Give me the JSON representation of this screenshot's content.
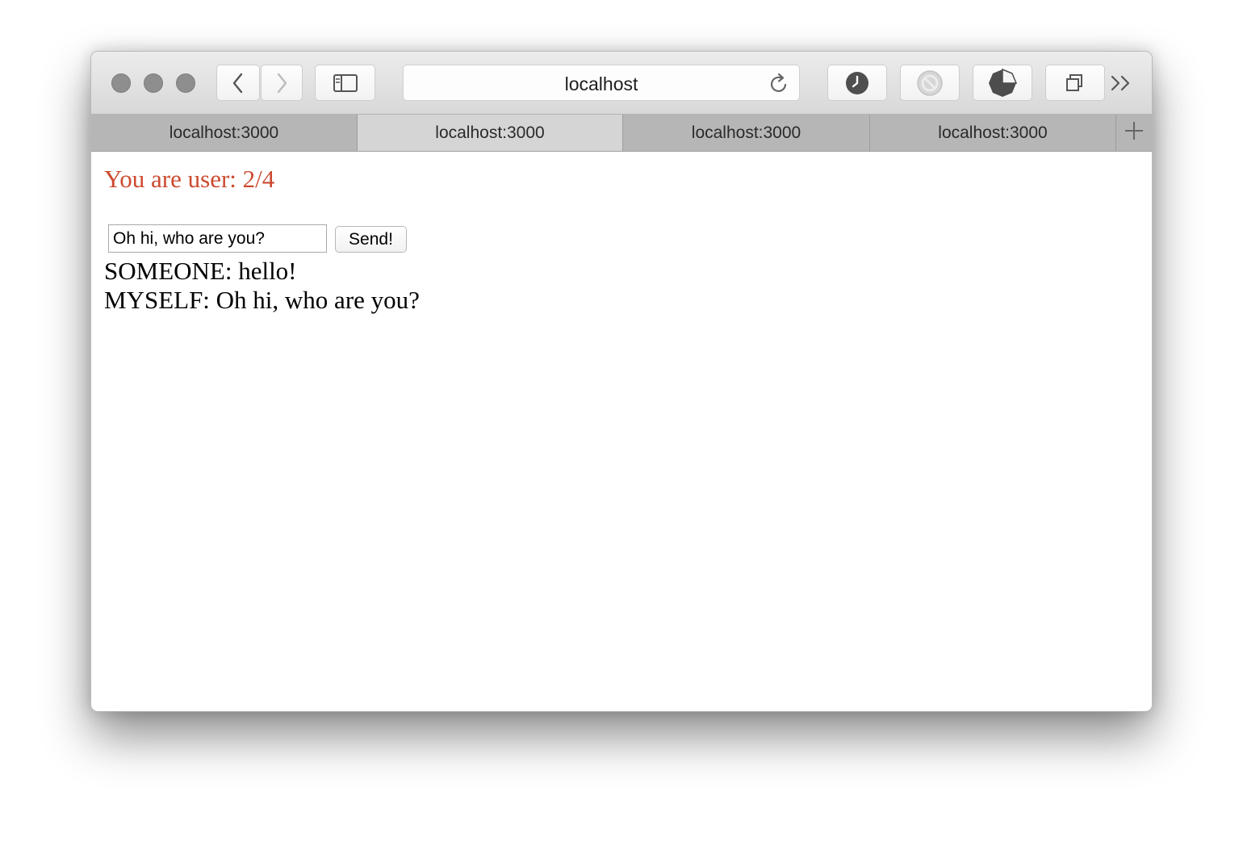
{
  "browser": {
    "address": "localhost",
    "tabs": [
      {
        "label": "localhost:3000",
        "active": false
      },
      {
        "label": "localhost:3000",
        "active": true
      },
      {
        "label": "localhost:3000",
        "active": false
      },
      {
        "label": "localhost:3000",
        "active": false
      }
    ],
    "icons": {
      "back": "chevron-left-icon",
      "forward": "chevron-right-icon",
      "sidebar": "sidebar-icon",
      "reload": "reload-icon",
      "history": "clock-icon",
      "blocker": "blocked-icon",
      "extension": "pie-icon",
      "tabs": "tab-overview-icon",
      "more": "double-chevron-icon",
      "new_tab": "plus-icon"
    }
  },
  "page": {
    "user_line": "You are user: 2/4",
    "user_line_color": "#cc4a2f",
    "input": {
      "value": "Oh hi, who are you?"
    },
    "send_label": "Send!",
    "messages": [
      "SOMEONE: hello!",
      "MYSELF: Oh hi, who are you?"
    ]
  }
}
